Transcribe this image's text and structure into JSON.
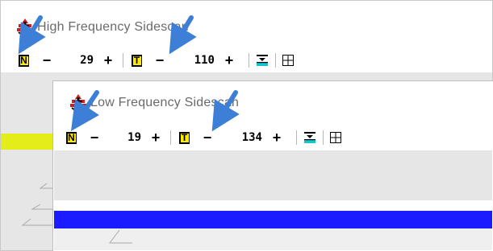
{
  "high_window": {
    "title": "High Frequency Sidescan",
    "toolbar": {
      "n_letter": "N",
      "n_minus": "−",
      "n_value": "29",
      "n_plus": "+",
      "t_letter": "T",
      "t_minus": "−",
      "t_value": "110",
      "t_plus": "+"
    }
  },
  "low_window": {
    "title": "Low Frequency Sidescan",
    "toolbar": {
      "n_letter": "N",
      "n_minus": "−",
      "n_value": "19",
      "n_plus": "+",
      "t_letter": "T",
      "t_minus": "−",
      "t_value": "134",
      "t_plus": "+"
    }
  },
  "colors": {
    "accent_blue": "#1b1bff",
    "indicator_yellow": "#e4ec1a",
    "annotation_arrow": "#3d7fd6",
    "logo_red": "#d11d1d"
  },
  "icons": [
    "app-logo-icon",
    "n-icon",
    "t-icon",
    "fill-levels-icon",
    "grid-icon",
    "annotation-arrow"
  ]
}
